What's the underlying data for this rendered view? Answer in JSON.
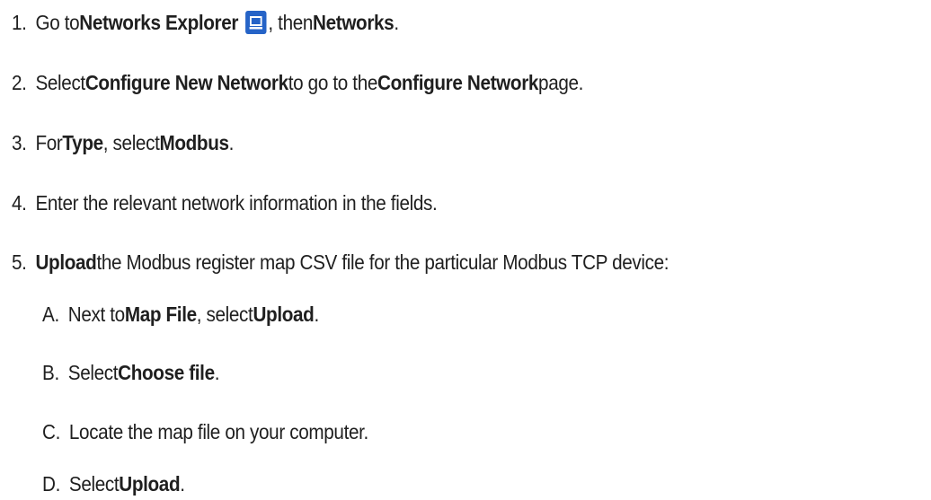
{
  "steps": [
    {
      "num": "1.",
      "pre": "Go to ",
      "bold1": "Networks Explorer",
      "icon": "monitor-icon",
      "mid": " , then ",
      "bold2": "Networks",
      "end": "."
    },
    {
      "num": "2.",
      "pre": "Select ",
      "bold1": "Configure New Network",
      "mid": " to go to the ",
      "bold2": "Configure Network",
      "end": " page."
    },
    {
      "num": "3.",
      "pre": "For ",
      "bold1": "Type",
      "mid": ", select ",
      "bold2": "Modbus",
      "end": "."
    },
    {
      "num": "4.",
      "text": "Enter the relevant network information in the fields."
    },
    {
      "num": "5.",
      "bold1": "Upload",
      "text": " the Modbus register map CSV file for the particular Modbus TCP device:"
    }
  ],
  "substeps": [
    {
      "num": "A.",
      "pre": "Next to ",
      "bold1": "Map File",
      "mid": ", select ",
      "bold2": "Upload",
      "end": "."
    },
    {
      "num": "B.",
      "pre": "Select ",
      "bold1": "Choose file",
      "end": "."
    },
    {
      "num": "C.",
      "text": "Locate the map file on your computer."
    },
    {
      "num": "D.",
      "pre": "Select ",
      "bold1": "Upload",
      "end": "."
    }
  ],
  "colors": {
    "text": "#1f1f1f",
    "icon_background": "#2563c7"
  }
}
